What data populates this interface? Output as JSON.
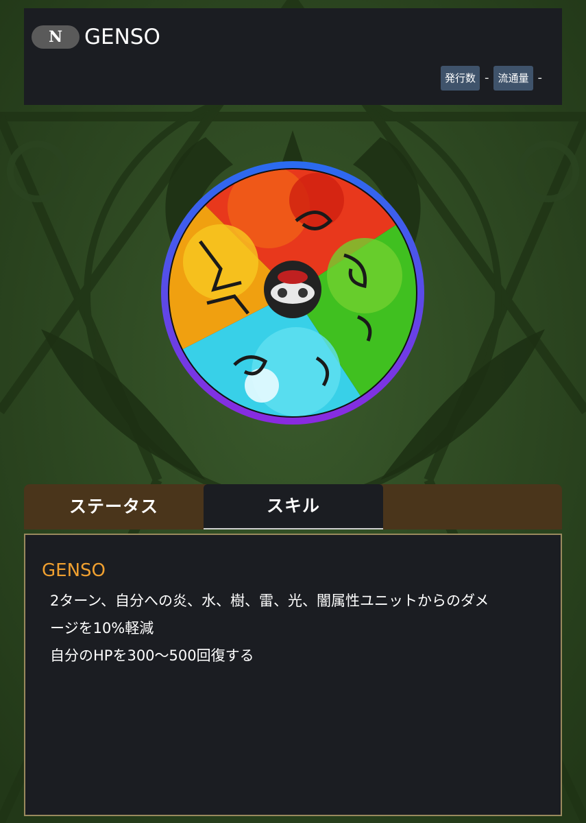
{
  "header": {
    "rarity": "N",
    "title": "GENSO",
    "issued_label": "発行数",
    "issued_value": "-",
    "circulation_label": "流通量",
    "circulation_value": "-"
  },
  "medal": {
    "icon": "genso-element-medal-icon",
    "colors": {
      "fire": "#e8381c",
      "thunder": "#f0a010",
      "wood": "#40c020",
      "water": "#38d0e8",
      "ring_top": "#2a6cf0",
      "ring_bottom": "#8a2ae0"
    }
  },
  "tabs": [
    {
      "label": "ステータス",
      "active": false
    },
    {
      "label": "スキル",
      "active": true
    }
  ],
  "skill": {
    "name": "GENSO",
    "description_lines": [
      "2ターン、自分への炎、水、樹、雷、光、闇属性ユニットからのダメ",
      "ージを10%軽減",
      "自分のHPを300〜500回復する"
    ]
  },
  "colors": {
    "background": "#2f4a24",
    "panel": "#1b1d22",
    "tab_bar": "#4a351b",
    "skill_name": "#f0a030",
    "badge": "#3f536b"
  }
}
